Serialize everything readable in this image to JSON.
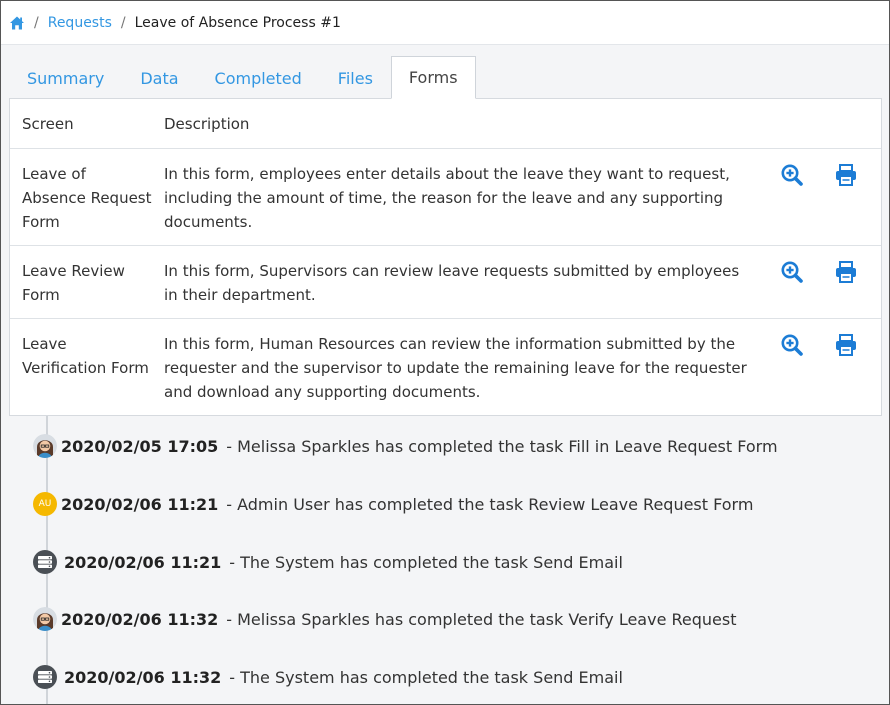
{
  "breadcrumb": {
    "home_icon": "home-icon",
    "separator": "/",
    "requests": "Requests",
    "current": "Leave of Absence Process #1"
  },
  "tabs": [
    {
      "label": "Summary",
      "active": false
    },
    {
      "label": "Data",
      "active": false
    },
    {
      "label": "Completed",
      "active": false
    },
    {
      "label": "Files",
      "active": false
    },
    {
      "label": "Forms",
      "active": true
    }
  ],
  "forms_table": {
    "headers": {
      "screen": "Screen",
      "description": "Description"
    },
    "rows": [
      {
        "screen": "Leave of Absence Request Form",
        "description": "In this form, employees enter details about the leave they want to request, including the amount of time, the reason for the leave and any supporting documents.",
        "actions": [
          "zoom-in-icon",
          "print-icon"
        ]
      },
      {
        "screen": "Leave Review Form",
        "description": "In this form, Supervisors can review leave requests submitted by employees in their department.",
        "actions": [
          "zoom-in-icon",
          "print-icon"
        ]
      },
      {
        "screen": "Leave Verification Form",
        "description": "In this form, Human Resources can review the information submitted by the requester and the supervisor to update the remaining leave for the requester and download any supporting documents.",
        "actions": [
          "zoom-in-icon",
          "print-icon"
        ]
      }
    ]
  },
  "timeline": [
    {
      "avatar": "person",
      "date": "2020/02/05 17:05",
      "text": "- Melissa Sparkles has completed the task Fill in Leave Request Form"
    },
    {
      "avatar": "initials",
      "initials": "AU",
      "date": "2020/02/06 11:21",
      "text": "- Admin User has completed the task Review Leave Request Form"
    },
    {
      "avatar": "system",
      "date": "2020/02/06 11:21",
      "text": "- The System has completed the task Send Email"
    },
    {
      "avatar": "person",
      "date": "2020/02/06 11:32",
      "text": "- Melissa Sparkles has completed the task Verify Leave Request"
    },
    {
      "avatar": "system",
      "date": "2020/02/06 11:32",
      "text": "- The System has completed the task Send Email"
    }
  ],
  "colors": {
    "link": "#3397e2",
    "icon_blue": "#1c7cd5",
    "initials_badge": "#f5b800",
    "system_badge": "#4a4f55"
  }
}
